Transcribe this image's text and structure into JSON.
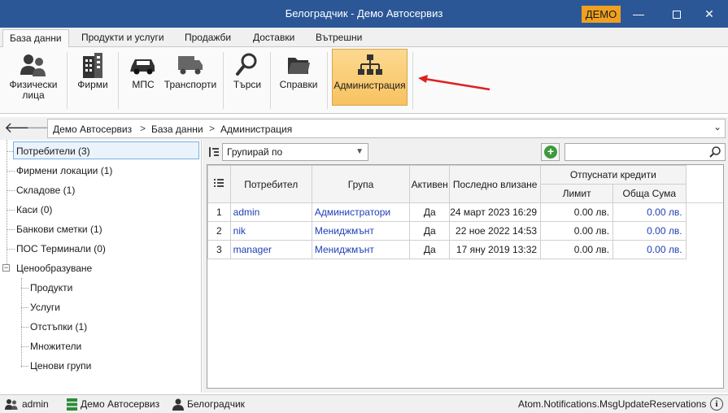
{
  "window": {
    "title": "Белоградчик - Демо Автосервиз",
    "badge": "ДЕМО",
    "minimize": "—",
    "close": "✕"
  },
  "tabs": [
    "База данни",
    "Продукти и услуги",
    "Продажби",
    "Доставки",
    "Вътрешни"
  ],
  "ribbon": {
    "individuals": "Физически\nлица",
    "firms": "Фирми",
    "vehicles": "МПС",
    "transport": "Транспорти",
    "search": "Търси",
    "reports": "Справки",
    "administration": "Администрация"
  },
  "nav": {
    "back": "🡐",
    "forward": "🡒",
    "breadcrumb": [
      "Демо Автосервиз",
      "База данни",
      "Администрация"
    ],
    "separator": ">",
    "dropdown": "⌄"
  },
  "tree": {
    "items": [
      "Потребители (3)",
      "Фирмени локации (1)",
      "Складове (1)",
      "Каси (0)",
      "Банкови сметки (1)",
      "ПОС Терминали (0)",
      "Ценообразуване"
    ],
    "pricing_children": [
      "Продукти",
      "Услуги",
      "Отстъпки (1)",
      "Множители",
      "Ценови групи"
    ],
    "expander": "−"
  },
  "toolbar": {
    "group_by": "Групирай по",
    "add": "+"
  },
  "grid": {
    "headers": {
      "user": "Потребител",
      "group": "Група",
      "active": "Активен",
      "last_login": "Последно влизане",
      "credits": "Отпуснати кредити",
      "limit": "Лимит",
      "total": "Обща Сума"
    },
    "rows": [
      {
        "n": "1",
        "user": "admin",
        "group": "Администратори",
        "active": "Да",
        "last_login": "24 март 2023 16:29",
        "limit": "0.00 лв.",
        "total": "0.00 лв."
      },
      {
        "n": "2",
        "user": "nik",
        "group": "Мениджмънт",
        "active": "Да",
        "last_login": "22 ное 2022 14:53",
        "limit": "0.00 лв.",
        "total": "0.00 лв."
      },
      {
        "n": "3",
        "user": "manager",
        "group": "Мениджмънт",
        "active": "Да",
        "last_login": "17 яну 2019 13:32",
        "limit": "0.00 лв.",
        "total": "0.00 лв."
      }
    ]
  },
  "status": {
    "user": "admin",
    "company": "Демо Автосервиз",
    "location": "Белоградчик",
    "message": "Atom.Notifications.MsgUpdateReservations",
    "info": "i"
  },
  "colors": {
    "titlebar": "#2b5797",
    "badge": "#f0a020",
    "link": "#1f3fb5",
    "active_ribbon": "#f8c260",
    "annotation_arrow": "#e02020"
  }
}
